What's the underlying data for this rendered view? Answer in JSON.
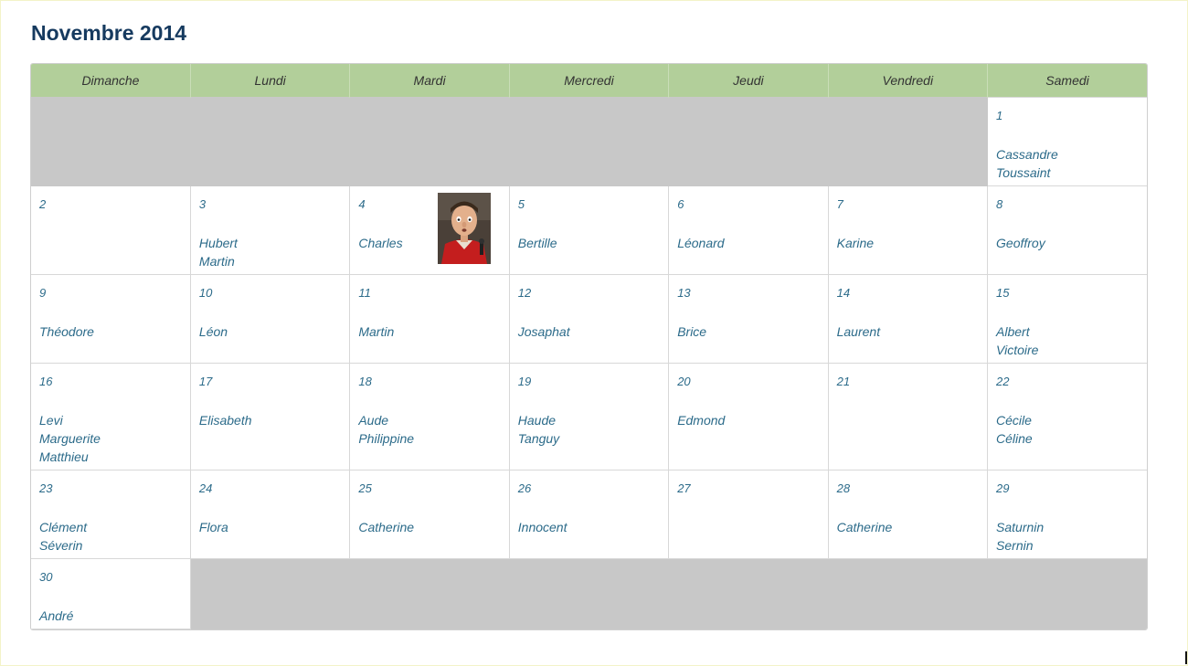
{
  "title": "Novembre 2014",
  "weekdays": [
    "Dimanche",
    "Lundi",
    "Mardi",
    "Mercredi",
    "Jeudi",
    "Vendredi",
    "Samedi"
  ],
  "days": {
    "d1": {
      "num": "1",
      "names": [
        "Cassandre",
        "Toussaint"
      ]
    },
    "d2": {
      "num": "2",
      "names": []
    },
    "d3": {
      "num": "3",
      "names": [
        "Hubert",
        "Martin"
      ]
    },
    "d4": {
      "num": "4",
      "names": [
        "Charles"
      ]
    },
    "d5": {
      "num": "5",
      "names": [
        "Bertille"
      ]
    },
    "d6": {
      "num": "6",
      "names": [
        "Léonard"
      ]
    },
    "d7": {
      "num": "7",
      "names": [
        "Karine"
      ]
    },
    "d8": {
      "num": "8",
      "names": [
        "Geoffroy"
      ]
    },
    "d9": {
      "num": "9",
      "names": [
        "Théodore"
      ]
    },
    "d10": {
      "num": "10",
      "names": [
        "Léon"
      ]
    },
    "d11": {
      "num": "11",
      "names": [
        "Martin"
      ]
    },
    "d12": {
      "num": "12",
      "names": [
        "Josaphat"
      ]
    },
    "d13": {
      "num": "13",
      "names": [
        "Brice"
      ]
    },
    "d14": {
      "num": "14",
      "names": [
        "Laurent"
      ]
    },
    "d15": {
      "num": "15",
      "names": [
        "Albert",
        "Victoire"
      ]
    },
    "d16": {
      "num": "16",
      "names": [
        "Levi",
        "Marguerite",
        "Matthieu"
      ]
    },
    "d17": {
      "num": "17",
      "names": [
        "Elisabeth"
      ]
    },
    "d18": {
      "num": "18",
      "names": [
        "Aude",
        "Philippine"
      ]
    },
    "d19": {
      "num": "19",
      "names": [
        "Haude",
        "Tanguy"
      ]
    },
    "d20": {
      "num": "20",
      "names": [
        "Edmond"
      ]
    },
    "d21": {
      "num": "21",
      "names": []
    },
    "d22": {
      "num": "22",
      "names": [
        "Cécile",
        "Céline"
      ]
    },
    "d23": {
      "num": "23",
      "names": [
        "Clément",
        "Séverin"
      ]
    },
    "d24": {
      "num": "24",
      "names": [
        "Flora"
      ]
    },
    "d25": {
      "num": "25",
      "names": [
        "Catherine"
      ]
    },
    "d26": {
      "num": "26",
      "names": [
        "Innocent"
      ]
    },
    "d27": {
      "num": "27",
      "names": []
    },
    "d28": {
      "num": "28",
      "names": [
        "Catherine"
      ]
    },
    "d29": {
      "num": "29",
      "names": [
        "Saturnin",
        "Sernin"
      ]
    },
    "d30": {
      "num": "30",
      "names": [
        "André"
      ]
    }
  },
  "colors": {
    "header_bg": "#b2cf9a",
    "empty_bg": "#c8c8c8",
    "title": "#163a5f",
    "text": "#2c6b8a"
  },
  "icons": {
    "d4_thumbnail": "cartoon-character-thumbnail"
  }
}
